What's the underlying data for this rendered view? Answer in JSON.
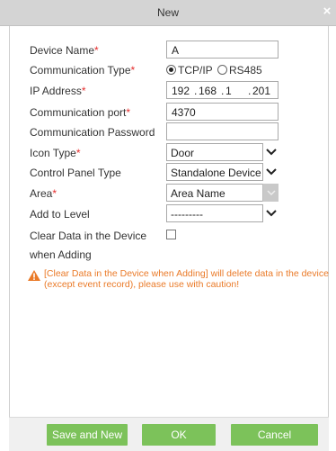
{
  "dialog": {
    "title": "New",
    "close_glyph": "×"
  },
  "form": {
    "device_name": {
      "label": "Device Name",
      "required_mark": "*",
      "value": "A"
    },
    "communication_type": {
      "label": "Communication Type",
      "required_mark": "*",
      "options": [
        "TCP/IP",
        "RS485"
      ],
      "selected": "TCP/IP"
    },
    "ip_address": {
      "label": "IP Address",
      "required_mark": "*",
      "octets": [
        "192",
        "168",
        "1",
        "201"
      ],
      "separator": "."
    },
    "communication_port": {
      "label": "Communication port",
      "required_mark": "*",
      "value": "4370"
    },
    "communication_password": {
      "label": "Communication Password",
      "value": ""
    },
    "icon_type": {
      "label": "Icon Type",
      "required_mark": "*",
      "value": "Door"
    },
    "control_panel_type": {
      "label": "Control Panel Type",
      "value": "Standalone Device"
    },
    "area": {
      "label": "Area",
      "required_mark": "*",
      "value": "Area Name",
      "disabled": true
    },
    "add_to_level": {
      "label": "Add to Level",
      "value": "---------"
    },
    "clear_data": {
      "label_line1": "Clear Data in the Device",
      "label_line2": "when Adding",
      "checked": false
    }
  },
  "warning": {
    "icon": "warning-triangle-icon",
    "text": "[Clear Data in the Device when Adding] will delete data in the device (except event record), please use with caution!"
  },
  "buttons": {
    "save_and_new": "Save and New",
    "ok": "OK",
    "cancel": "Cancel"
  },
  "colors": {
    "button_green": "#7cc25a",
    "required_red": "#e52c2c",
    "warning_orange": "#ea7a28",
    "titlebar_gray": "#d4d4d4"
  }
}
